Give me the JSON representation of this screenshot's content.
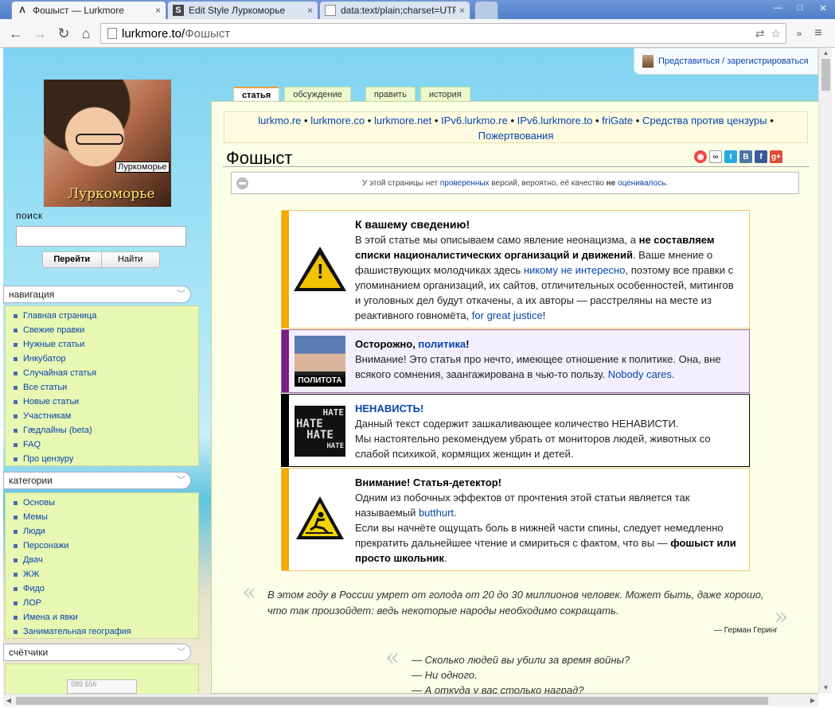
{
  "browser": {
    "tabs": [
      {
        "title": "Фошыст — Lurkmore",
        "icon": "lurk-lambda-icon",
        "active": true
      },
      {
        "title": "Edit Style Луркоморье",
        "icon": "stylish-icon",
        "active": false
      },
      {
        "title": "data:text/plain;charset=UTF",
        "icon": "page-icon",
        "active": false
      }
    ],
    "close_glyph": "×",
    "url_host": "lurkmore.to/",
    "url_path": "Фошыст"
  },
  "userbar": {
    "login_text": "Представиться / зарегистрироваться"
  },
  "logo": {
    "caption": "Луркоморье",
    "tooltip": "Луркоморье"
  },
  "search": {
    "label": "поиск",
    "go_label": "Перейти",
    "find_label": "Найти",
    "value": ""
  },
  "sidebar": {
    "navigation": {
      "title": "навигация",
      "items": [
        "Главная страница",
        "Свежие правки",
        "Нужные статьи",
        "Инкубатор",
        "Случайная статья",
        "Все статьи",
        "Новые статьи",
        "Участникам",
        "Гæдлайны (beta)",
        "FAQ",
        "Про цензуру"
      ]
    },
    "categories": {
      "title": "категории",
      "items": [
        "Основы",
        "Мемы",
        "Люди",
        "Персонажи",
        "Двач",
        "ЖЖ",
        "Фидо",
        "ЛОР",
        "Имена и явки",
        "Занимательная география"
      ]
    },
    "counters": {
      "title": "счётчики",
      "counter_text": "589 556"
    }
  },
  "content_tabs": [
    "статья",
    "обсуждение",
    "править",
    "история"
  ],
  "sitenotice": {
    "links": [
      "lurkmo.re",
      "lurkmore.co",
      "lurkmore.net",
      "IPv6.lurkmo.re",
      "IPv6.lurkmore.to",
      "friGate",
      "Средства против цензуры",
      "Пожертвования"
    ],
    "separator": "•"
  },
  "article": {
    "title": "Фошыст",
    "flagged": {
      "pre": "У этой страницы нет ",
      "link1": "проверенных",
      "mid": " версий, вероятно, её качество ",
      "bold": "не",
      "link2": "оценивалось",
      "post": "."
    },
    "boxes": [
      {
        "title": "К вашему сведению!",
        "p1": "В этой статье мы описываем само явление неонацизма, а ",
        "p1b": "не составляем списки националистических организаций и движений",
        "p2": ". Ваше мнение о фашиствующих молодчиках здесь ",
        "link1": "никому не интересно",
        "p3": ", поэтому все правки с упоминанием организаций, их сайтов, отличительных особенностей, митингов и уголовных дел будут откачены, а их авторы — расстреляны на месте из реактивного говномёта, ",
        "link2": "for great justice",
        "p4": "!",
        "stripe": "#f2a900"
      },
      {
        "title_pre": "Осторожно, ",
        "title_link": "политика",
        "title_post": "!",
        "body": "Внимание! Это статья про нечто, имеющее отношение к политике. Она, вне всякого сомнения, заангажирована в чью-то пользу. ",
        "link": "Nobody cares",
        "post": ".",
        "image_label": "ПОЛИТОТА",
        "stripe": "#7a1f86"
      },
      {
        "title": "НЕНАВИСТЬ!",
        "line1": "Данный текст содержит зашкаливающее количество НЕНАВИСТИ.",
        "line2": "Мы настоятельно рекомендуем убрать от мониторов людей, животных со слабой психикой, кормящих женщин и детей.",
        "image_words": [
          "HATE",
          "HATE",
          "HATE",
          "HATE"
        ],
        "stripe": "#000000"
      },
      {
        "title": "Внимание! Статья-детектор!",
        "p1": "Одним из побочных эффектов от прочтения этой статьи является так называемый ",
        "link": "butthurt",
        "p1_end": ".",
        "p2": "Если вы начнёте ощущать боль в нижней части спины, следует немедленно прекратить дальнейшее чтение и смириться с фактом, что вы — ",
        "p2b": "фошыст или просто школьник",
        "p2_end": ".",
        "stripe": "#f2a900"
      }
    ],
    "quote1": {
      "text": "В этом году в России умрет от голода от 20 до 30 миллионов человек. Может быть, даже хорошо, что так произойдет: ведь некоторые народы необходимо сокращать.",
      "author": "— Герман Геринг"
    },
    "quote2": {
      "lines": [
        "— Сколько людей вы убили за время войны?",
        "— Ни одного.",
        "— А откуда у вас столько наград?"
      ]
    },
    "quote_open": "«",
    "quote_close": "»"
  }
}
